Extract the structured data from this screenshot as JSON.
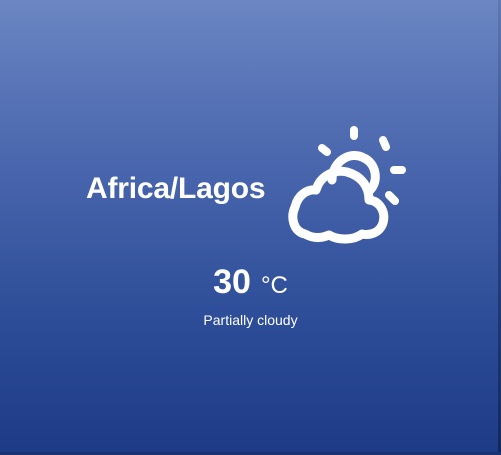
{
  "weather": {
    "location": "Africa/Lagos",
    "temperature": "30",
    "unit": "°C",
    "condition": "Partially cloudy",
    "icon": "partly-cloudy-icon"
  },
  "colors": {
    "background_top": "#6b86c2",
    "background_bottom": "#1d3a86",
    "text": "#ffffff"
  }
}
